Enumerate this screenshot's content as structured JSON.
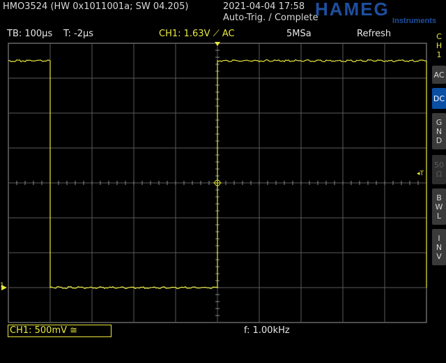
{
  "header": {
    "device": "HMO3524 (HW 0x1011001a; SW 04.205)",
    "datetime": "2021-04-04 17:58",
    "trigger_status": "Auto-Trig. / Complete",
    "brand": "HAMEG",
    "brand_sub": "Instruments"
  },
  "status": {
    "timebase": "TB: 100µs",
    "trigger_time": "T: -2µs",
    "channel": "CH1: 1.63V ⟋ AC",
    "sample_rate": "5MSa",
    "mode": "Refresh"
  },
  "sidebar": {
    "channel_label": "C\nH\n1",
    "buttons": [
      {
        "label": "AC",
        "state": "normal"
      },
      {
        "label": "DC",
        "state": "active"
      },
      {
        "label": "G\nN\nD",
        "state": "normal"
      },
      {
        "label": "50\nΩ",
        "state": "dim"
      },
      {
        "label": "B\nW\nL",
        "state": "normal"
      },
      {
        "label": "I\nN\nV",
        "state": "normal"
      }
    ]
  },
  "footer": {
    "channel_scale": "CH1: 500mV ≅",
    "frequency": "f: 1.00kHz"
  },
  "markers": {
    "trigger_level": "◂T",
    "ground": "1"
  },
  "colors": {
    "trace": "#e8e840",
    "grid": "#5a5a5a",
    "active_button": "#0a4fa3"
  },
  "chart_data": {
    "type": "line",
    "title": "",
    "xlabel": "",
    "ylabel": "",
    "x_unit": "µs",
    "y_unit": "V",
    "xlim": [
      -502,
      498
    ],
    "ylim": [
      -2,
      2
    ],
    "grid": true,
    "series": [
      {
        "x": [
          -502,
          -402,
          -402,
          -2,
          -2,
          498
        ],
        "y": [
          1.75,
          1.75,
          -1.5,
          -1.5,
          1.75,
          1.75
        ]
      },
      {
        "x": [
          498,
          498,
          498
        ],
        "y": [
          1.75,
          -1.5,
          -1.5
        ]
      }
    ]
  }
}
